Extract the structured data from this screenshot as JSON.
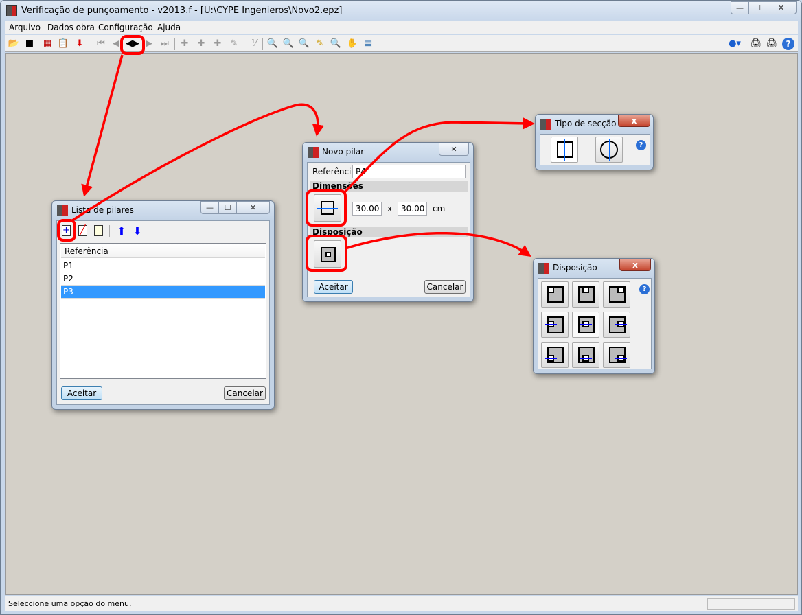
{
  "window": {
    "title": "Verificação de punçoamento - v2013.f - [U:\\CYPE Ingenieros\\Novo2.epz]",
    "minimize": "—",
    "maximize": "☐",
    "close": "✕"
  },
  "menu": [
    "Arquivo",
    "Dados obra",
    "Configuração",
    "Ajuda"
  ],
  "toolbar": {
    "icons": [
      "open-folder-icon",
      "save-icon",
      "brick-wall-icon",
      "clipboard-edit-icon",
      "import-icon",
      "first-icon",
      "previous-icon",
      "edit-list-icon",
      "next-icon",
      "last-icon",
      "column-add-icon",
      "column-delete-icon",
      "column-edit-icon",
      "column-move-icon",
      "formula-icon",
      "zoom-window-icon",
      "zoom-all-icon",
      "zoom-x2-icon",
      "redraw-icon",
      "zoom-previous-icon",
      "pan-hand-icon",
      "refresh-icon",
      "globe-icon",
      "print-icon",
      "plotter-icon",
      "help-icon"
    ]
  },
  "status": {
    "text": "Seleccione uma opção do menu."
  },
  "lista": {
    "title": "Lista de pilares",
    "header": "Referência",
    "rows": [
      "P1",
      "P2",
      "P3"
    ],
    "selected": "P3",
    "accept": "Aceitar",
    "cancel": "Cancelar",
    "minimize": "—",
    "maximize": "☐",
    "close": "✕"
  },
  "novo": {
    "title": "Novo pilar",
    "ref_label": "Referência",
    "ref_value": "P4",
    "dim_section": "Dimensões",
    "dim_x": "30.00",
    "times": "x",
    "dim_y": "30.00",
    "unit": "cm",
    "disp_section": "Disposição",
    "accept": "Aceitar",
    "cancel": "Cancelar",
    "close": "✕"
  },
  "tipo": {
    "title": "Tipo de secção",
    "close": "x",
    "options": [
      "rectangular",
      "circular"
    ]
  },
  "disposicao": {
    "title": "Disposição",
    "close": "x",
    "selected": "center"
  },
  "colors": {
    "annotation": "#ff0000",
    "selection": "#3399ff",
    "workspace": "#d4d0c8"
  }
}
